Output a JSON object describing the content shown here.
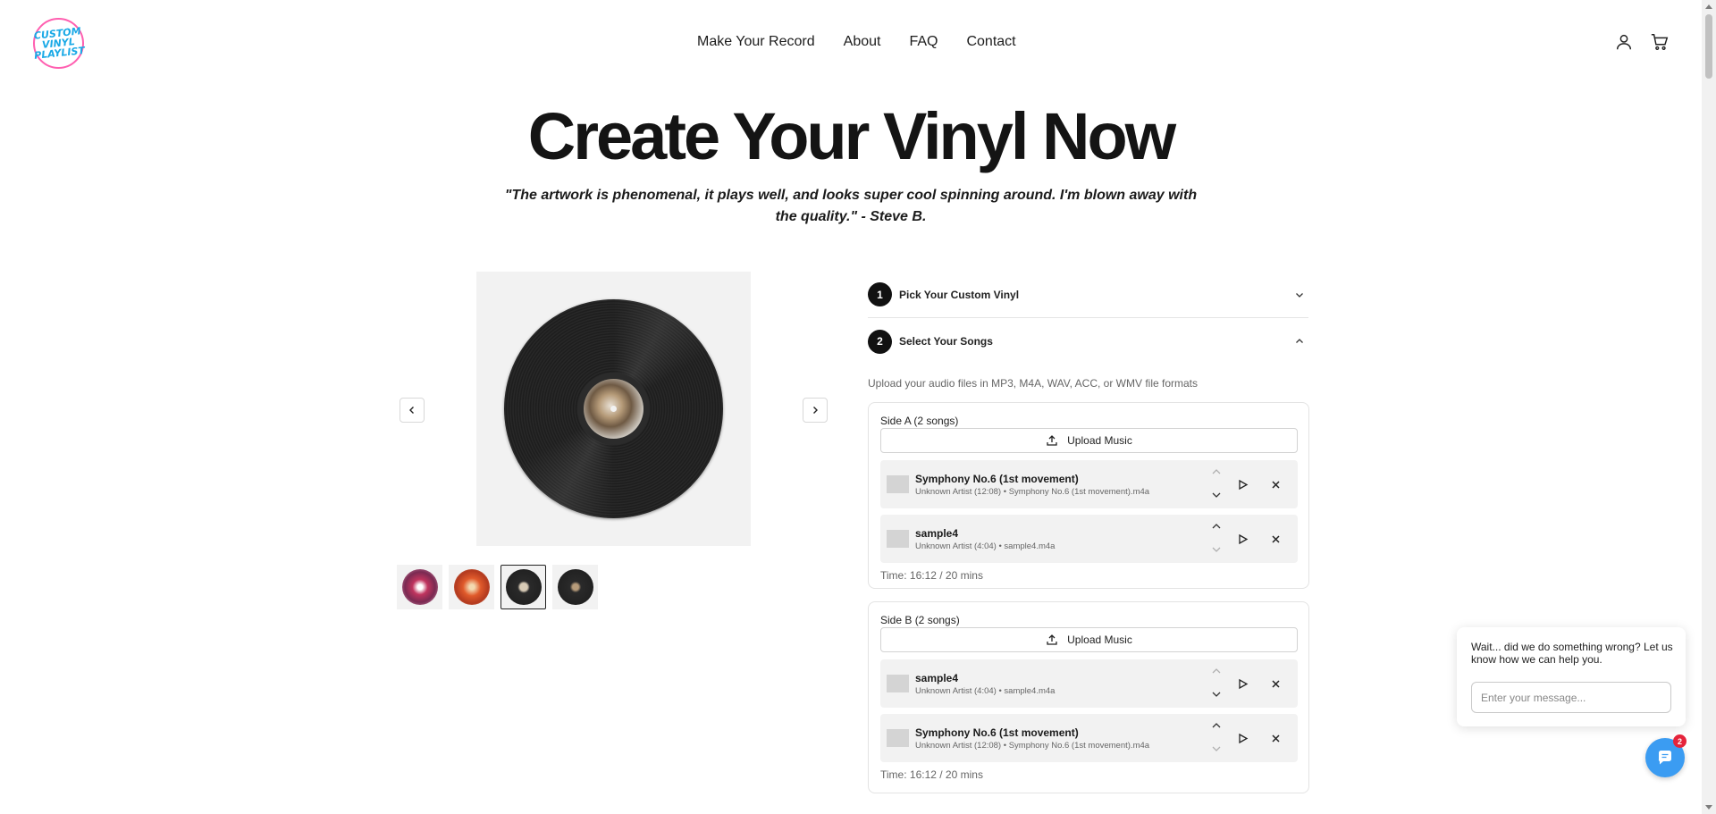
{
  "logo": {
    "text": "CUSTOM VINYL PLAYLIST"
  },
  "nav": {
    "items": [
      "Make Your Record",
      "About",
      "FAQ",
      "Contact"
    ]
  },
  "header_icons": [
    "user-icon",
    "cart-icon"
  ],
  "hero": {
    "title": "Create Your Vinyl Now",
    "quote": "\"The artwork is phenomenal, it plays well, and looks super cool spinning around. I'm blown away with the quality.\" - Steve B."
  },
  "gallery": {
    "thumbnail_count": 4,
    "active_thumbnail": 3
  },
  "steps": [
    {
      "number": "1",
      "label": "Pick Your Custom Vinyl",
      "expanded": false
    },
    {
      "number": "2",
      "label": "Select Your Songs",
      "expanded": true
    }
  ],
  "help_text": "Upload your audio files in MP3, M4A, WAV, ACC, or WMV file formats",
  "upload_label": "Upload Music",
  "sides": [
    {
      "title": "Side A (2 songs)",
      "songs": [
        {
          "name": "Symphony No.6 (1st movement)",
          "meta": "Unknown Artist (12:08) • Symphony No.6 (1st movement).m4a"
        },
        {
          "name": "sample4",
          "meta": "Unknown Artist (4:04) • sample4.m4a"
        }
      ],
      "time": "Time: 16:12 / 20 mins"
    },
    {
      "title": "Side B (2 songs)",
      "songs": [
        {
          "name": "sample4",
          "meta": "Unknown Artist (4:04) • sample4.m4a"
        },
        {
          "name": "Symphony No.6 (1st movement)",
          "meta": "Unknown Artist (12:08) • Symphony No.6 (1st movement).m4a"
        }
      ],
      "time": "Time: 16:12 / 20 mins"
    }
  ],
  "chat": {
    "message": "Wait... did we do something wrong? Let us know how we can help you.",
    "placeholder": "Enter your message...",
    "badge": "2"
  },
  "colors": {
    "accent": "#111111",
    "chat_button": "#3b9cf2",
    "badge": "#e5243b",
    "logo_ring": "#ff5fb0",
    "logo_text": "#19a9e6"
  }
}
